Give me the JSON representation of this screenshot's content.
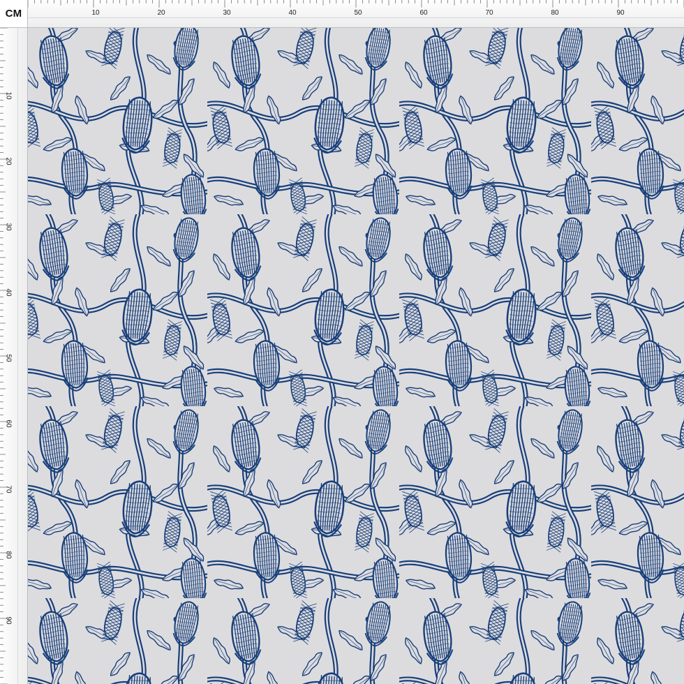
{
  "ruler": {
    "unit": "CM",
    "x_ticks": [
      "10",
      "20",
      "30",
      "40",
      "50",
      "60",
      "70",
      "80",
      "90"
    ],
    "y_ticks": [
      "10",
      "20",
      "30",
      "40",
      "50",
      "60",
      "70",
      "80",
      "90"
    ]
  },
  "pattern": {
    "background_color": "#dcdcdf",
    "ink_color": "#193f7a",
    "motif_icon": "banksia-flower-icon",
    "leaf_icon": "serrated-leaf-icon"
  }
}
